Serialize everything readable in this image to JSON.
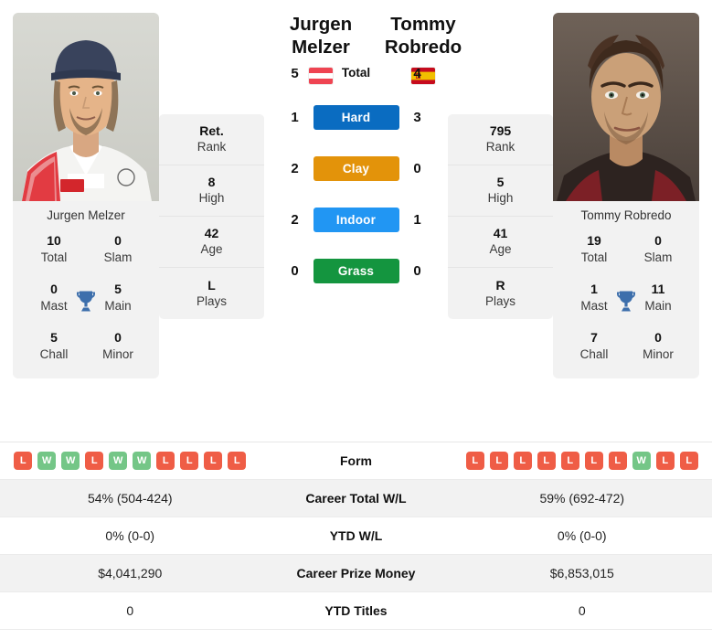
{
  "players": {
    "left": {
      "first_name": "Jurgen",
      "last_name": "Melzer",
      "full_name": "Jurgen Melzer",
      "caption": "Jurgen Melzer",
      "flag": "austria-flag-icon",
      "h2h_total": "5",
      "titles": {
        "total_val": "10",
        "total_lab": "Total",
        "slam_val": "0",
        "slam_lab": "Slam",
        "mast_val": "0",
        "mast_lab": "Mast",
        "main_val": "5",
        "main_lab": "Main",
        "chall_val": "5",
        "chall_lab": "Chall",
        "minor_val": "0",
        "minor_lab": "Minor"
      },
      "stats": [
        {
          "value": "Ret.",
          "label": "Rank"
        },
        {
          "value": "8",
          "label": "High"
        },
        {
          "value": "42",
          "label": "Age"
        },
        {
          "value": "L",
          "label": "Plays"
        }
      ],
      "form": [
        "L",
        "W",
        "W",
        "L",
        "W",
        "W",
        "L",
        "L",
        "L",
        "L"
      ],
      "career_total_wl": "54% (504-424)",
      "ytd_wl": "0% (0-0)",
      "career_prize_money": "$4,041,290",
      "ytd_titles": "0"
    },
    "right": {
      "first_name": "Tommy",
      "last_name": "Robredo",
      "full_name": "Tommy Robredo",
      "caption": "Tommy Robredo",
      "flag": "spain-flag-icon",
      "h2h_total": "4",
      "titles": {
        "total_val": "19",
        "total_lab": "Total",
        "slam_val": "0",
        "slam_lab": "Slam",
        "mast_val": "1",
        "mast_lab": "Mast",
        "main_val": "11",
        "main_lab": "Main",
        "chall_val": "7",
        "chall_lab": "Chall",
        "minor_val": "0",
        "minor_lab": "Minor"
      },
      "stats": [
        {
          "value": "795",
          "label": "Rank"
        },
        {
          "value": "5",
          "label": "High"
        },
        {
          "value": "41",
          "label": "Age"
        },
        {
          "value": "R",
          "label": "Plays"
        }
      ],
      "form": [
        "L",
        "L",
        "L",
        "L",
        "L",
        "L",
        "L",
        "W",
        "L",
        "L"
      ],
      "career_total_wl": "59% (692-472)",
      "ytd_wl": "0% (0-0)",
      "career_prize_money": "$6,853,015",
      "ytd_titles": "0"
    }
  },
  "head_to_head": {
    "total_label": "Total",
    "surfaces": [
      {
        "name": "Hard",
        "left": "1",
        "right": "3",
        "color": "#0a6cc1"
      },
      {
        "name": "Clay",
        "left": "2",
        "right": "0",
        "color": "#e3930a"
      },
      {
        "name": "Indoor",
        "left": "2",
        "right": "1",
        "color": "#2196f3"
      },
      {
        "name": "Grass",
        "left": "0",
        "right": "0",
        "color": "#14953f"
      }
    ]
  },
  "table": {
    "rows": [
      {
        "label": "Form"
      },
      {
        "label": "Career Total W/L"
      },
      {
        "label": "YTD W/L"
      },
      {
        "label": "Career Prize Money"
      },
      {
        "label": "YTD Titles"
      }
    ]
  },
  "icons": {
    "trophy": "trophy-icon"
  },
  "colors": {
    "win": "#74c687",
    "loss": "#ef5d46",
    "card_bg": "#f2f2f2",
    "trophy": "#3d6fac"
  }
}
